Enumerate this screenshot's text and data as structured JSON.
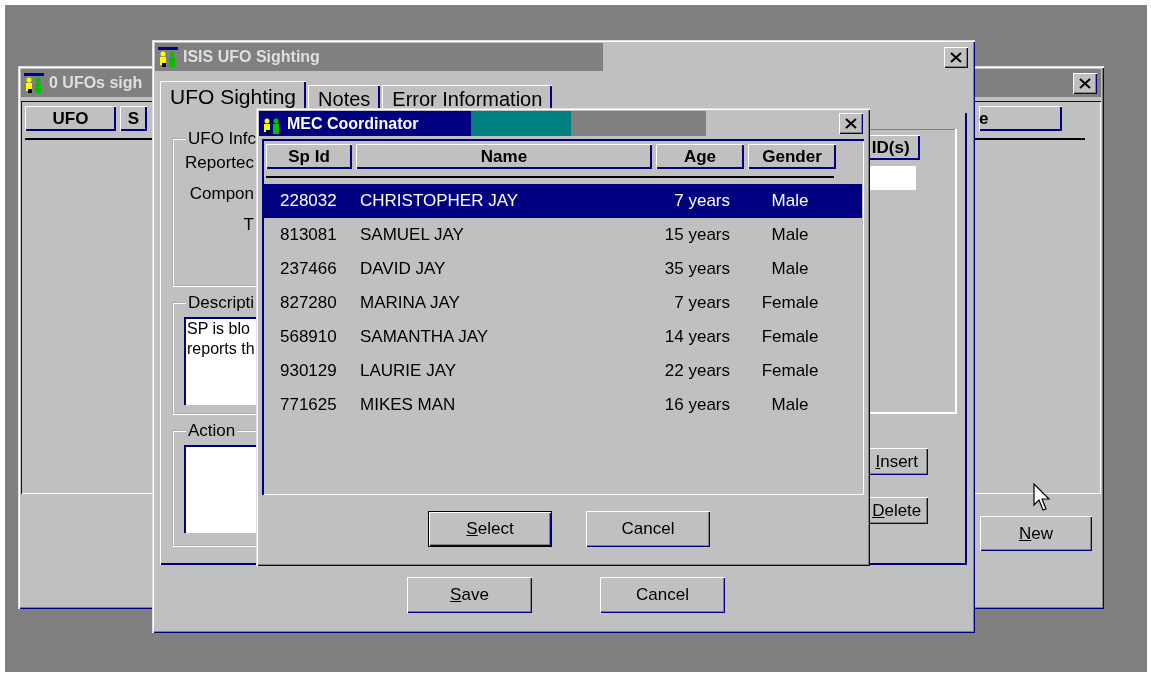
{
  "back_window": {
    "title": "0 UFOs sigh",
    "columns": [
      "UFO",
      "S",
      "e"
    ],
    "buttons": [
      {
        "mnemonic": "N",
        "rest": "ew"
      }
    ]
  },
  "sighting_window": {
    "title": "ISIS UFO Sighting",
    "tabs": [
      {
        "label": "UFO Sighting",
        "selected": true
      },
      {
        "label": "Notes",
        "selected": false
      },
      {
        "label": "Error Information",
        "selected": false
      }
    ],
    "ufo_info": {
      "title": "UFO Infc",
      "labels": [
        "Reportec",
        "Compon",
        "T"
      ]
    },
    "description": {
      "title": "Descripti",
      "lines": [
        "SP is blo",
        "reports th"
      ]
    },
    "action": {
      "title": "Action"
    },
    "ids_column": "ID(s)",
    "side_buttons": [
      {
        "mnemonic": "I",
        "rest": "nsert"
      },
      {
        "mnemonic": "D",
        "rest": "elete"
      }
    ],
    "buttons": [
      {
        "mnemonic": "S",
        "rest": "ave"
      },
      {
        "label": "Cancel"
      }
    ]
  },
  "dialog": {
    "title": "MEC Coordinator",
    "columns": [
      "Sp Id",
      "Name",
      "Age",
      "Gender"
    ],
    "rows": [
      {
        "sp_id": "228032",
        "name": "CHRISTOPHER JAY",
        "age": "7 years",
        "gender": "Male",
        "selected": true
      },
      {
        "sp_id": "813081",
        "name": "SAMUEL JAY",
        "age": "15 years",
        "gender": "Male",
        "selected": false
      },
      {
        "sp_id": "237466",
        "name": "DAVID JAY",
        "age": "35 years",
        "gender": "Male",
        "selected": false
      },
      {
        "sp_id": "827280",
        "name": "MARINA JAY",
        "age": "7 years",
        "gender": "Female",
        "selected": false
      },
      {
        "sp_id": "568910",
        "name": "SAMANTHA JAY",
        "age": "14 years",
        "gender": "Female",
        "selected": false
      },
      {
        "sp_id": "930129",
        "name": "LAURIE JAY",
        "age": "22 years",
        "gender": "Female",
        "selected": false
      },
      {
        "sp_id": "771625",
        "name": "MIKES MAN",
        "age": "16 years",
        "gender": "Male",
        "selected": false
      }
    ],
    "buttons": [
      {
        "mnemonic": "S",
        "rest": "elect",
        "default": true
      },
      {
        "label": "Cancel",
        "default": false
      }
    ]
  }
}
